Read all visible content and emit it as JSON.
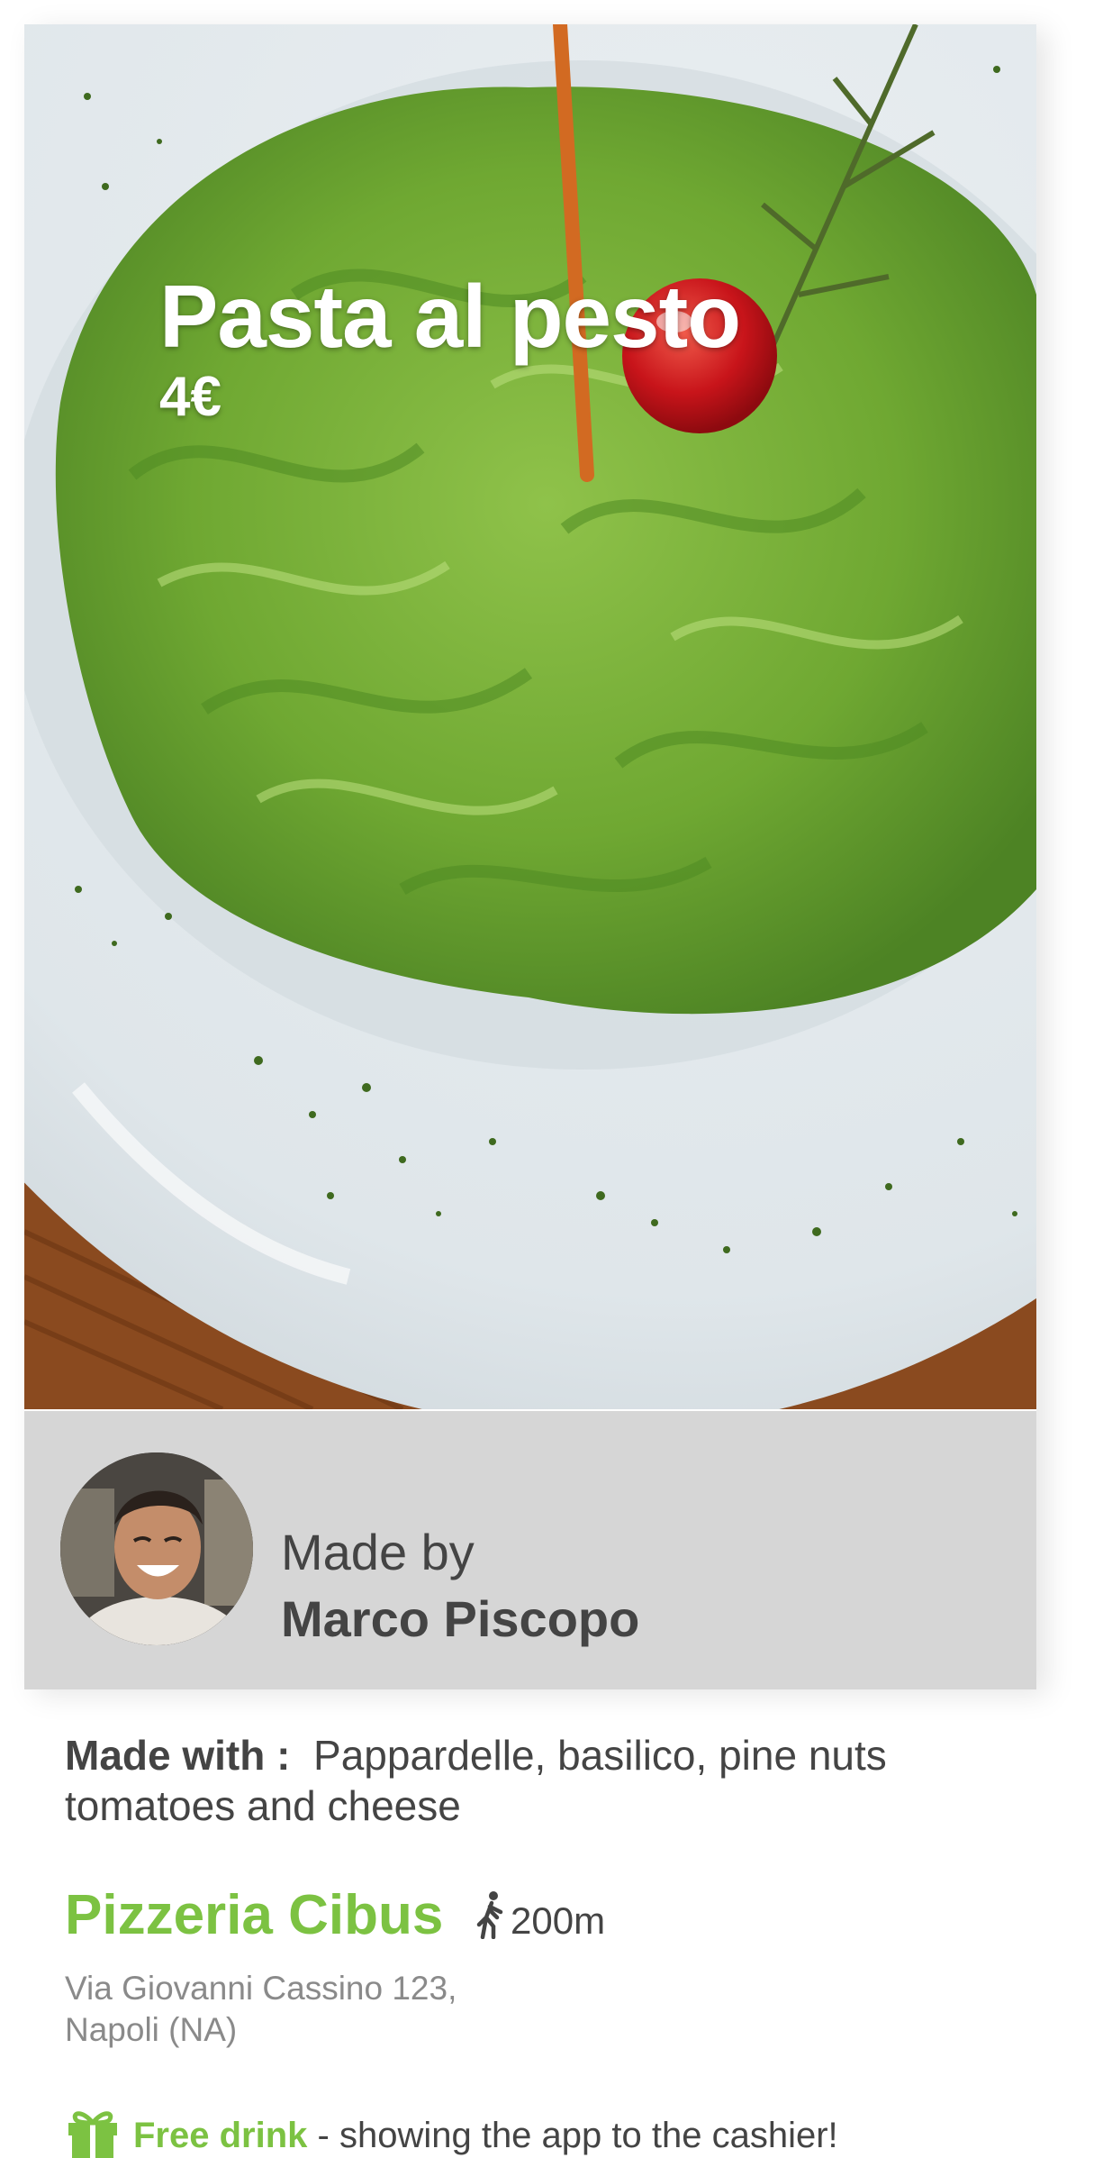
{
  "dish": {
    "name": "Pasta al pesto",
    "price": "4€",
    "image_icon": "pasta-photo"
  },
  "chef": {
    "made_by_label": "Made by",
    "name": "Marco Piscopo",
    "avatar_icon": "chef-avatar"
  },
  "ingredients": {
    "label": "Made with :",
    "text": "Pappardelle, basilico, pine nuts tomatoes and cheese"
  },
  "restaurant": {
    "name": "Pizzeria Cibus",
    "distance": "200m",
    "distance_icon": "walking-person-icon",
    "address_line1": "Via Giovanni Cassino 123,",
    "address_line2": "Napoli (NA)"
  },
  "promo": {
    "icon": "gift-icon",
    "highlight": "Free drink",
    "text": " - showing the app to the cashier!"
  },
  "colors": {
    "accent": "#7cc242",
    "text": "#444444",
    "muted": "#8a8a8a",
    "panel": "#d6d6d6"
  }
}
